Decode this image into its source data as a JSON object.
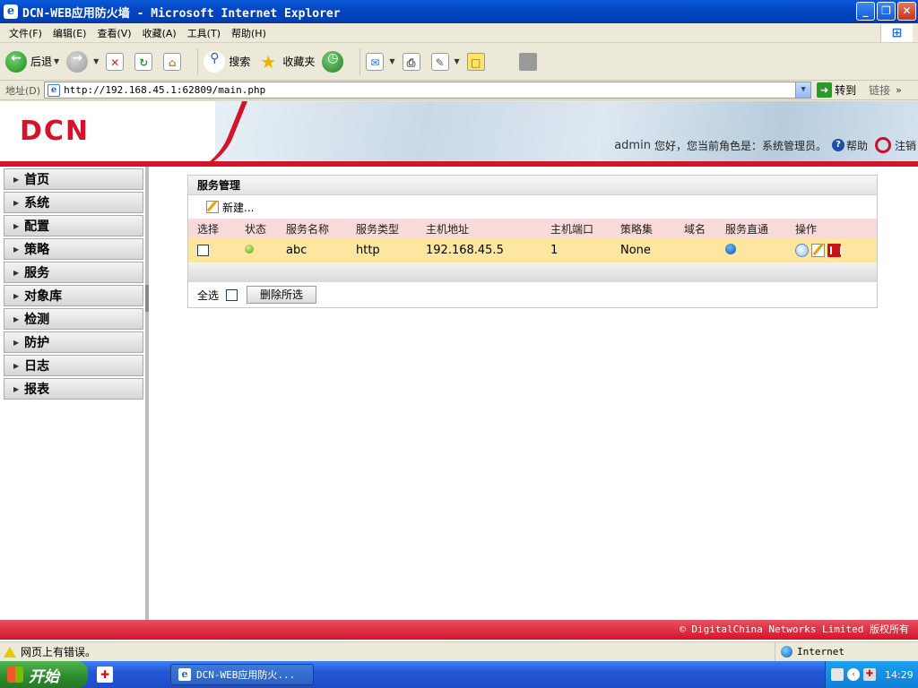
{
  "window": {
    "title": "DCN-WEB应用防火墙 - Microsoft Internet Explorer",
    "ie_glyph": "e",
    "minimize_glyph": "_",
    "restore_glyph": "❐",
    "close_glyph": "✕"
  },
  "menu": {
    "items": [
      "文件(F)",
      "编辑(E)",
      "查看(V)",
      "收藏(A)",
      "工具(T)",
      "帮助(H)"
    ],
    "xp_logo": "⊞"
  },
  "toolbar": {
    "back_label": "后退",
    "search_label": "搜索",
    "favorites_label": "收藏夹",
    "back_glyph": "←",
    "forward_glyph": "→",
    "stop_glyph": "✕",
    "refresh_glyph": "↻",
    "home_glyph": "⌂",
    "search_glyph": "⚲",
    "star_glyph": "★",
    "history_glyph": "◷",
    "mail_glyph": "✉",
    "print_glyph": "⎙",
    "edit_glyph": "✎",
    "note_glyph": "□"
  },
  "address": {
    "label": "地址(D)",
    "url": "http://192.168.45.1:62809/main.php",
    "page_glyph": "e",
    "go_label": "转到",
    "go_glyph": "➜",
    "links_label": "链接",
    "links_glyph": "»"
  },
  "banner": {
    "logo": "DCN",
    "username": "admin",
    "greeting": "您好，您当前角色是：系统管理员。",
    "help_glyph": "?",
    "help_label": "帮助",
    "logout_label": "注销"
  },
  "sidebar": {
    "items": [
      {
        "label": "首页"
      },
      {
        "label": "系统"
      },
      {
        "label": "配置"
      },
      {
        "label": "策略"
      },
      {
        "label": "服务"
      },
      {
        "label": "对象库"
      },
      {
        "label": "检测"
      },
      {
        "label": "防护"
      },
      {
        "label": "日志"
      },
      {
        "label": "报表"
      }
    ]
  },
  "panel": {
    "title": "服务管理",
    "new_label": "新建...",
    "columns": [
      "选择",
      "状态",
      "服务名称",
      "服务类型",
      "主机地址",
      "主机端口",
      "策略集",
      "域名",
      "服务直通",
      "操作"
    ],
    "rows": [
      {
        "name": "abc",
        "type": "http",
        "host": "192.168.45.5",
        "port": "1",
        "policy": "None",
        "domain": ""
      }
    ],
    "select_all_label": "全选",
    "delete_selected_label": "删除所选"
  },
  "footer": {
    "copyright": "© DigitalChina Networks Limited 版权所有"
  },
  "statusbar": {
    "message": "网页上有错误。",
    "zone": "Internet"
  },
  "taskbar": {
    "start_label": "开始",
    "quick_glyph": "✚",
    "task_label": "DCN-WEB应用防火...",
    "task_glyph": "e",
    "chevron_glyph": "‹",
    "tray_glyph": "✚",
    "clock": "14:29"
  },
  "colors": {
    "brand_red": "#d4142a",
    "row_highlight": "#fde6a0",
    "header_row": "#f8dada",
    "xp_blue": "#0240b5"
  }
}
